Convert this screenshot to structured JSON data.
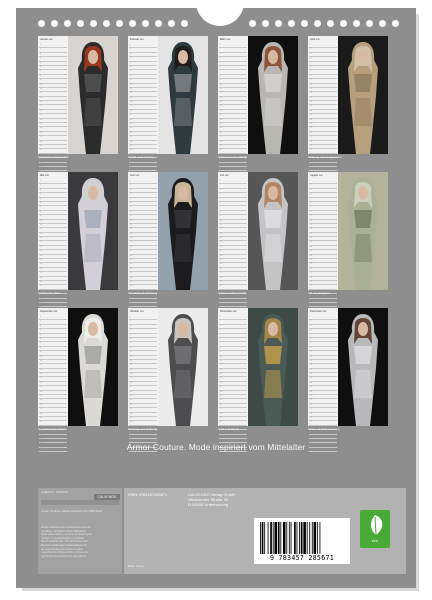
{
  "calendar": {
    "title": "Armor Couture. Mode inspiriert vom Mittelalter",
    "months": [
      {
        "label": "Januar xxx",
        "caption": "Schwarzes Rabenkleid",
        "colors": {
          "bg": "#d7d4d2",
          "main": "#2b2b2b",
          "hair": "#a63a1e",
          "accent": "#5a5a5a"
        }
      },
      {
        "label": "Februar xxx",
        "caption": "Metall und Umhang",
        "colors": {
          "bg": "#e4e4e4",
          "main": "#2f3a3e",
          "hair": "#1f1a16",
          "accent": "#8c8f90"
        }
      },
      {
        "label": "März xxx",
        "caption": "Schimmerndes Metall",
        "colors": {
          "bg": "#0f0f0f",
          "main": "#b9b7b4",
          "hair": "#8a4a2a",
          "accent": "#d9d7d4"
        }
      },
      {
        "label": "April xxx",
        "caption": "Rüstung und langes Haar",
        "colors": {
          "bg": "#1a1a1a",
          "main": "#b69f7c",
          "hair": "#d3c3aa",
          "accent": "#8a7a5e"
        }
      },
      {
        "label": "Mai xxx",
        "caption": "Schillernde Robe",
        "colors": {
          "bg": "#3a3a3c",
          "main": "#d3cfd6",
          "hair": "#cfcfcf",
          "accent": "#9fa4b6"
        }
      },
      {
        "label": "Juni xxx",
        "caption": "Sinnstiftende Rüstung",
        "colors": {
          "bg": "#93a1ad",
          "main": "#1b1b1d",
          "hair": "#d9c7a0",
          "accent": "#3b3b3e"
        }
      },
      {
        "label": "Juli xxx",
        "caption": "Sicheres Ritter-Outfit",
        "colors": {
          "bg": "#565656",
          "main": "#c4c4c6",
          "hair": "#b07e5a",
          "accent": "#e4e4e6"
        }
      },
      {
        "label": "August xxx",
        "caption": "Stil und Eleganz",
        "colors": {
          "bg": "#b3b29b",
          "main": "#aab096",
          "hair": "#d0d3c2",
          "accent": "#6f7a60"
        }
      },
      {
        "label": "September xxx",
        "caption": "Geschmücktes Kleid",
        "colors": {
          "bg": "#0f0f0f",
          "main": "#dcdad6",
          "hair": "#eeeeee",
          "accent": "#9a9a9a"
        }
      },
      {
        "label": "Oktober xxx",
        "caption": "Rüstung und Umhang",
        "colors": {
          "bg": "#ececec",
          "main": "#4d4d4f",
          "hair": "#d6d2c8",
          "accent": "#7a7a7c"
        }
      },
      {
        "label": "November xxx",
        "caption": "Gold und Metall",
        "colors": {
          "bg": "#3e4a46",
          "main": "#4a5a55",
          "hair": "#b08a4a",
          "accent": "#d1a64a"
        }
      },
      {
        "label": "Dezember xxx",
        "caption": "Mode mit Schimmerung",
        "colors": {
          "bg": "#0f0f0f",
          "main": "#b9b9bc",
          "hair": "#5a3a28",
          "accent": "#e0e0e2"
        }
      }
    ]
  },
  "day_numbers": [
    "1",
    "2",
    "3",
    "4",
    "5",
    "6",
    "7",
    "8",
    "9",
    "10",
    "11",
    "12",
    "13",
    "14",
    "15",
    "16",
    "17",
    "18",
    "19",
    "20",
    "21",
    "22",
    "23",
    "24",
    "25",
    "26",
    "27",
    "28",
    "29",
    "30",
    "31"
  ],
  "back": {
    "left_header": "Artikel-Nr.: 1944754",
    "calvendo_logo": "CALVENDO",
    "left_title": "Armor Couture. Mode inspiriert vom Mittelalter",
    "left_text": [
      "Erfolge stabilisierende Grundelemente sind die",
      "Grundlage, die Modern Wesen Ritterlichen",
      "Mode weiterzuführen und diese Entwicklung der",
      "Vorlagen zu gesellschaftlichen Ansichten",
      "dieses Zeitabschnitts. Hier kombinieren sich",
      "Elemente traditioneller Handwerkskunst mit",
      "der neuen Design-Konzeption zu einem",
      "ungewöhnlichen Modeerlebnis. (12 Kalender",
      "nach Ihrem Geschmack) Inkl. Jahresplaner"
    ],
    "isbn": "ISBN 9783457285671",
    "publisher_lines": [
      "CALVENDO Verlag GmbH",
      "Ottobrunner Straße 39",
      "D-82008 Unterhaching"
    ],
    "author": "Brian Hurley",
    "barcode_digits": "9 783457 285671",
    "eco_label": "eco"
  }
}
